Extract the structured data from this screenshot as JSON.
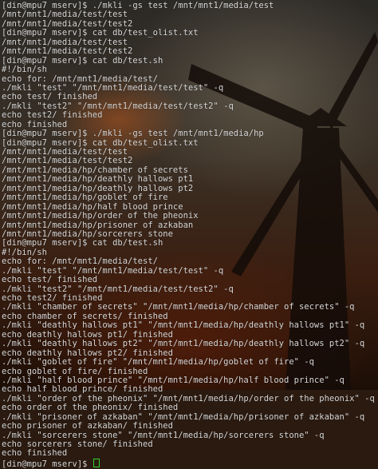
{
  "terminal": {
    "lines": [
      "[din@mpu7 mserv]$ ./mkli -gs test /mnt/mnt1/media/test",
      "/mnt/mnt1/media/test/test",
      "/mnt/mnt1/media/test/test2",
      "[din@mpu7 mserv]$ cat db/test_olist.txt",
      "/mnt/mnt1/media/test/test",
      "/mnt/mnt1/media/test/test2",
      "[din@mpu7 mserv]$ cat db/test.sh",
      "#!/bin/sh",
      "echo for: /mnt/mnt1/media/test/",
      "./mkli \"test\" \"/mnt/mnt1/media/test/test\" -q",
      "echo test/ finished",
      "./mkli \"test2\" \"/mnt/mnt1/media/test/test2\" -q",
      "echo test2/ finished",
      "echo finished",
      "[din@mpu7 mserv]$ ./mkli -gs test /mnt/mnt1/media/hp",
      "[din@mpu7 mserv]$ cat db/test_olist.txt",
      "/mnt/mnt1/media/test/test",
      "/mnt/mnt1/media/test/test2",
      "/mnt/mnt1/media/hp/chamber of secrets",
      "/mnt/mnt1/media/hp/deathly hallows pt1",
      "/mnt/mnt1/media/hp/deathly hallows pt2",
      "/mnt/mnt1/media/hp/goblet of fire",
      "/mnt/mnt1/media/hp/half blood prince",
      "/mnt/mnt1/media/hp/order of the pheonix",
      "/mnt/mnt1/media/hp/prisoner of azkaban",
      "/mnt/mnt1/media/hp/sorcerers stone",
      "[din@mpu7 mserv]$ cat db/test.sh",
      "#!/bin/sh",
      "echo for: /mnt/mnt1/media/test/",
      "./mkli \"test\" \"/mnt/mnt1/media/test/test\" -q",
      "echo test/ finished",
      "./mkli \"test2\" \"/mnt/mnt1/media/test/test2\" -q",
      "echo test2/ finished",
      "./mkli \"chamber of secrets\" \"/mnt/mnt1/media/hp/chamber of secrets\" -q",
      "echo chamber of secrets/ finished",
      "./mkli \"deathly hallows pt1\" \"/mnt/mnt1/media/hp/deathly hallows pt1\" -q",
      "echo deathly hallows pt1/ finished",
      "./mkli \"deathly hallows pt2\" \"/mnt/mnt1/media/hp/deathly hallows pt2\" -q",
      "echo deathly hallows pt2/ finished",
      "./mkli \"goblet of fire\" \"/mnt/mnt1/media/hp/goblet of fire\" -q",
      "echo goblet of fire/ finished",
      "./mkli \"half blood prince\" \"/mnt/mnt1/media/hp/half blood prince\" -q",
      "echo half blood prince/ finished",
      "./mkli \"order of the pheonix\" \"/mnt/mnt1/media/hp/order of the pheonix\" -q",
      "echo order of the pheonix/ finished",
      "./mkli \"prisoner of azkaban\" \"/mnt/mnt1/media/hp/prisoner of azkaban\" -q",
      "echo prisoner of azkaban/ finished",
      "./mkli \"sorcerers stone\" \"/mnt/mnt1/media/hp/sorcerers stone\" -q",
      "echo sorcerers stone/ finished",
      "echo finished"
    ],
    "prompt": "[din@mpu7 mserv]$ ",
    "colors": {
      "text": "#d8d8d8",
      "cursor": "#2fd32f"
    }
  }
}
